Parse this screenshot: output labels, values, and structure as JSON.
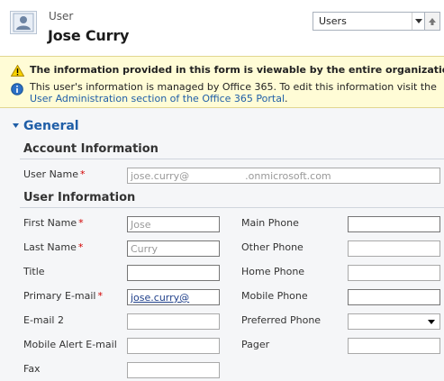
{
  "header": {
    "record_type": "User",
    "record_name": "Jose Curry",
    "form_selector": {
      "value": "Users"
    }
  },
  "notifications": {
    "warning": "The information provided in this form is viewable by the entire organization.",
    "info_prefix": "This user's information is managed by Office 365. To edit this information visit the ",
    "info_link": "User Administration section of the Office 365 Portal",
    "info_suffix": "."
  },
  "tab": {
    "label": "General"
  },
  "sections": {
    "account": {
      "title": "Account Information",
      "user_name": {
        "label": "User Name",
        "value_user": "jose.curry@",
        "value_domain": ".onmicrosoft.com"
      }
    },
    "user_info": {
      "title": "User Information",
      "left_fields": [
        {
          "label": "First Name",
          "required": "*",
          "value": "Jose"
        },
        {
          "label": "Last Name",
          "required": "*",
          "value": "Curry"
        },
        {
          "label": "Title",
          "required": "",
          "value": ""
        },
        {
          "label": "Primary E-mail",
          "required": "*",
          "value": "jose.curry@"
        },
        {
          "label": "E-mail 2",
          "required": "",
          "value": ""
        },
        {
          "label": "Mobile Alert E-mail",
          "required": "",
          "value": ""
        },
        {
          "label": "Fax",
          "required": "",
          "value": ""
        }
      ],
      "right_fields": [
        {
          "label": "Main Phone",
          "value": ""
        },
        {
          "label": "Other Phone",
          "value": ""
        },
        {
          "label": "Home Phone",
          "value": ""
        },
        {
          "label": "Mobile Phone",
          "value": ""
        },
        {
          "label": "Preferred Phone",
          "value": ""
        },
        {
          "label": "Pager",
          "value": ""
        }
      ]
    }
  },
  "icons": {
    "avatar": "user-avatar-icon",
    "warning": "warning-icon",
    "info": "info-icon",
    "collapse": "collapse-triangle-icon",
    "dropdown": "chevron-down-icon",
    "up": "arrow-up-icon"
  },
  "colors": {
    "accent": "#1f5ea7",
    "required": "#d20000",
    "notification_bg": "#fffcd6"
  }
}
